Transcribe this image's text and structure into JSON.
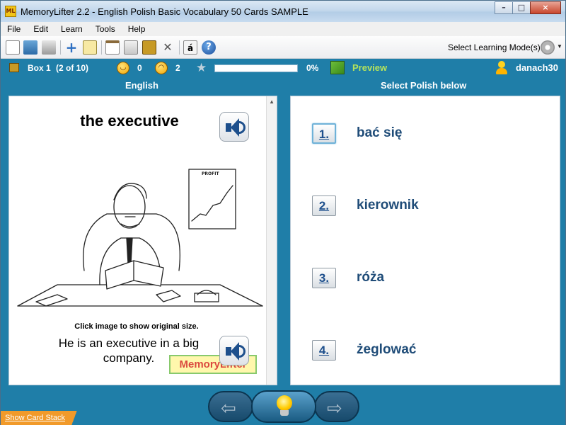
{
  "window": {
    "app_icon_text": "ML",
    "title": "MemoryLifter 2.2 - English Polish Basic Vocabulary 50 Cards SAMPLE",
    "minimize": "–",
    "maximize": "□",
    "close": "×"
  },
  "menu": [
    "File",
    "Edit",
    "Learn",
    "Tools",
    "Help"
  ],
  "toolbar": {
    "icons": [
      "new-icon",
      "open-icon",
      "print-icon",
      "add-card-icon",
      "edit-icon",
      "presentation-icon",
      "statistics-icon",
      "card-box-icon",
      "tools-icon",
      "special-char-icon",
      "help-icon"
    ],
    "special_char": "á",
    "help": "?",
    "mode_label": "Select Learning Mode(s)"
  },
  "status": {
    "box": "Box 1",
    "box_count": "(2 of 10)",
    "correct": "0",
    "wrong": "2",
    "progress_percent": 0,
    "progress_label": "0%",
    "preview": "Preview",
    "user": "danach30"
  },
  "columns": {
    "left": "English",
    "right": "Select Polish below"
  },
  "card": {
    "question": "the executive",
    "chart_sign": "PROFIT",
    "caption": "Click image to show original size.",
    "example": "He is an executive in a big company.",
    "logo": "MemoryLifter"
  },
  "answers": [
    {
      "num": "1.",
      "text": "bać się",
      "selected": true
    },
    {
      "num": "2.",
      "text": "kierownik",
      "selected": false
    },
    {
      "num": "3.",
      "text": "róża",
      "selected": false
    },
    {
      "num": "4.",
      "text": "żeglować",
      "selected": false
    }
  ],
  "nav": {
    "back": "⇦",
    "forward": "⇨"
  },
  "show_card_stack": "Show Card Stack"
}
